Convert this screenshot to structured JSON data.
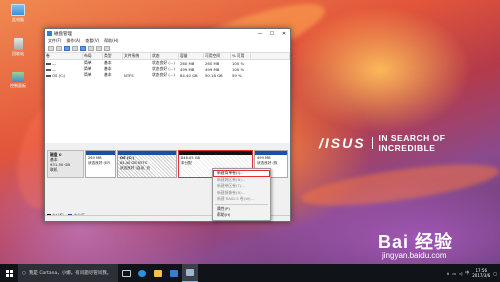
{
  "desktop": {
    "icons": [
      {
        "label": "此电脑",
        "name": "this-pc"
      },
      {
        "label": "回收站",
        "name": "recycle-bin"
      },
      {
        "label": "控制面板",
        "name": "control-panel"
      }
    ],
    "brand_logo": "/ISUS",
    "brand_slogan": "IN SEARCH OF INCREDIBLE",
    "watermark_logo": "Bai 经验",
    "watermark_url": "jingyan.baidu.com"
  },
  "window": {
    "title": "磁盘管理",
    "controls": {
      "minimize": "—",
      "maximize": "☐",
      "close": "✕"
    },
    "menu": [
      "文件(F)",
      "操作(A)",
      "查看(V)",
      "帮助(H)"
    ],
    "columns": [
      "卷",
      "布局",
      "类型",
      "文件系统",
      "状态",
      "容量",
      "可用空间",
      "% 可用",
      ""
    ],
    "volumes": [
      {
        "volume": "—",
        "layout": "简单",
        "type": "基本",
        "fs": "",
        "status": "状态良好 (...)",
        "capacity": "260 MB",
        "free": "260 MB",
        "pct": "100 %"
      },
      {
        "volume": "—",
        "layout": "简单",
        "type": "基本",
        "fs": "",
        "status": "状态良好 (...)",
        "capacity": "499 MB",
        "free": "499 MB",
        "pct": "100 %"
      },
      {
        "volume": "OS (C:)",
        "layout": "简单",
        "type": "基本",
        "fs": "NTFS",
        "status": "状态良好 (...)",
        "capacity": "84.40 GB",
        "free": "50.18 GB",
        "pct": "59 %"
      }
    ],
    "disk": {
      "name": "磁盘 0",
      "kind": "基本",
      "size": "931.50 GB",
      "state": "联机"
    },
    "partitions": [
      {
        "title": "",
        "size": "260 MB",
        "status": "状态良好 (EFI"
      },
      {
        "title": "OS (C:)",
        "size": "84.40 GB NTFS",
        "status": "状态良好 (启动, 页"
      },
      {
        "title": "",
        "size": "846.05 GB",
        "status": "未分配"
      },
      {
        "title": "",
        "size": "499 MB",
        "status": "状态良好 (恢"
      }
    ],
    "legend": [
      {
        "label": "未分配",
        "color": "#111111"
      },
      {
        "label": "主分区",
        "color": "#1f4ea8"
      }
    ]
  },
  "context_menu": {
    "items": [
      {
        "label": "新建简单卷(I)...",
        "enabled": true,
        "highlighted": true
      },
      {
        "label": "新建跨区卷(N)...",
        "enabled": false
      },
      {
        "label": "新建带区卷(T)...",
        "enabled": false
      },
      {
        "label": "新建镜像卷(R)...",
        "enabled": false
      },
      {
        "label": "新建 RAID-5 卷(W)...",
        "enabled": false
      },
      {
        "label": "属性(P)",
        "enabled": true,
        "sep_before": true
      },
      {
        "label": "帮助(H)",
        "enabled": true
      }
    ]
  },
  "taskbar": {
    "search_placeholder": "我是 Cortana，小娜。有问题尽管问我。",
    "time": "17:56",
    "date": "2017/3/6",
    "ime": "中"
  }
}
